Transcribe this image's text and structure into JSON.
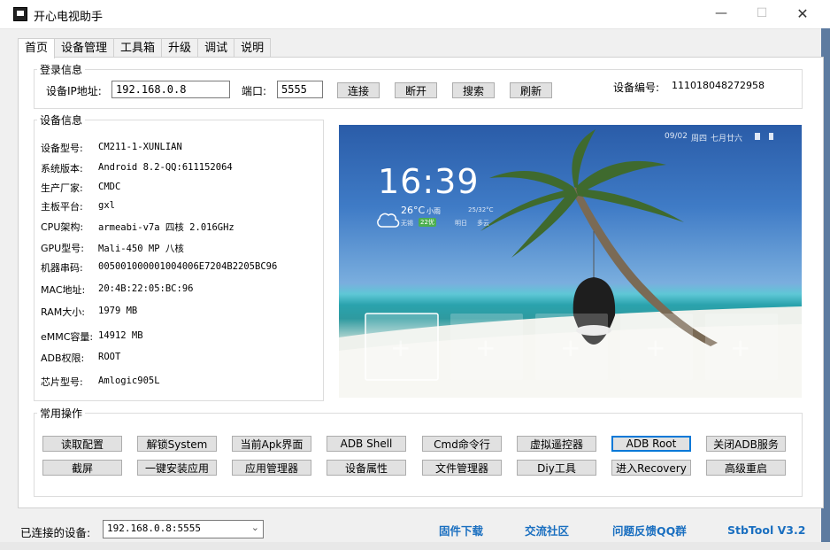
{
  "window": {
    "title": "开心电视助手",
    "minimize": "—",
    "maximize": "☐",
    "close": "✕"
  },
  "tabs": [
    "首页",
    "设备管理",
    "工具箱",
    "升级",
    "调试",
    "说明"
  ],
  "login": {
    "group_title": "登录信息",
    "ip_label": "设备IP地址:",
    "ip_value": "192.168.0.8",
    "port_label": "端口:",
    "port_value": "5555",
    "buttons": [
      "连接",
      "断开",
      "搜索",
      "刷新"
    ],
    "device_no_label": "设备编号:",
    "device_no_value": "111018048272958"
  },
  "device_info": {
    "group_title": "设备信息",
    "rows": [
      {
        "label": "设备型号:",
        "value": "CM211-1-XUNLIAN"
      },
      {
        "label": "系统版本:",
        "value": "Android 8.2-QQ:611152064"
      },
      {
        "label": "生产厂家:",
        "value": "CMDC"
      },
      {
        "label": "主板平台:",
        "value": "gxl"
      },
      {
        "label": "CPU架构:",
        "value": "armeabi-v7a 四核 2.016GHz"
      },
      {
        "label": "GPU型号:",
        "value": "Mali-450 MP 八核"
      },
      {
        "label": "机器串码:",
        "value": "0050010000010040​06E7204B2205BC96"
      },
      {
        "label": "MAC地址:",
        "value": "20:4B:22:05:BC:96"
      },
      {
        "label": "RAM大小:",
        "value": "1979 MB"
      },
      {
        "label": "eMMC容量:",
        "value": "14912 MB"
      },
      {
        "label": "ADB权限:",
        "value": "ROOT"
      },
      {
        "label": "芯片型号:",
        "value": "Amlogic905L"
      }
    ]
  },
  "preview": {
    "time": "16:39",
    "date": "09/02",
    "weekday": "周四",
    "lunar": "七月廿六",
    "temp": "26°C",
    "weather": "小雨",
    "wind": "无锡",
    "aqi": "22优",
    "tomorrow_range": "25/32°C",
    "tomorrow_label": "明日",
    "tomorrow_weather": "多云",
    "plus": "+"
  },
  "common_ops": {
    "group_title": "常用操作",
    "row1": [
      "读取配置",
      "解锁System",
      "当前Apk界面",
      "ADB Shell",
      "Cmd命令行",
      "虚拟遥控器",
      "ADB  Root",
      "关闭ADB服务"
    ],
    "row2": [
      "截屏",
      "一键安装应用",
      "应用管理器",
      "设备属性",
      "文件管理器",
      "Diy工具",
      "进入Recovery",
      "高级重启"
    ]
  },
  "footer": {
    "connected_label": "已连接的设备:",
    "connected_value": "192.168.0.8:5555",
    "links": [
      "固件下载",
      "交流社区",
      "问题反馈QQ群",
      "StbTool V3.2"
    ]
  },
  "colors": {
    "accent": "#0078d7",
    "link": "#1a6fc0"
  }
}
